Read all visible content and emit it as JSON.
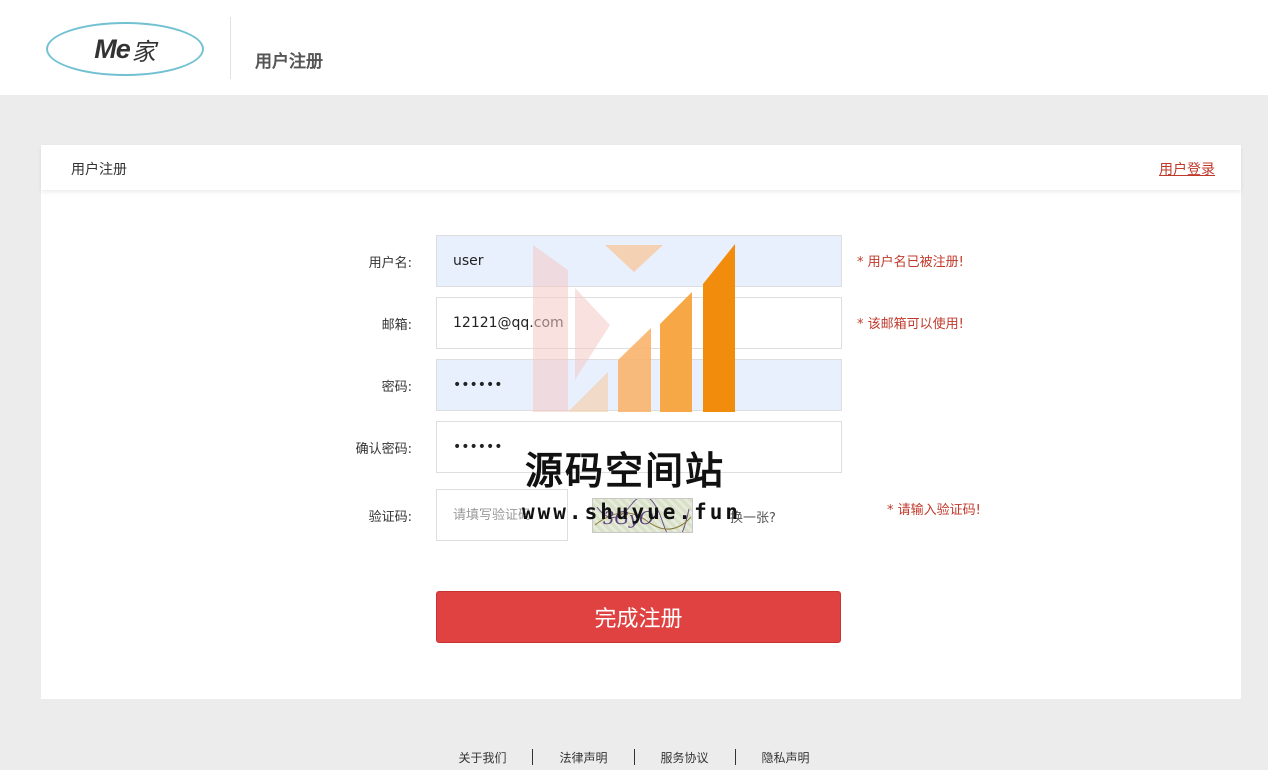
{
  "header": {
    "logo_text": "Me",
    "logo_text_cn": "家",
    "title": "用户注册"
  },
  "panel": {
    "title": "用户注册",
    "login_link": "用户登录"
  },
  "form": {
    "username": {
      "label": "用户名:",
      "value": "user",
      "hint": "* 用户名已被注册!"
    },
    "email": {
      "label": "邮箱:",
      "value": "12121@qq.com",
      "hint": "* 该邮箱可以使用!"
    },
    "password": {
      "label": "密码:",
      "value": "123456"
    },
    "confirm_password": {
      "label": "确认密码:",
      "value": "123456"
    },
    "captcha": {
      "label": "验证码:",
      "placeholder": "请填写验证码",
      "image_text": "3GyO",
      "refresh": "换一张?",
      "hint": "* 请输入验证码!"
    },
    "submit": "完成注册"
  },
  "watermark": {
    "title": "源码空间站",
    "url": "www.shuyue.fun"
  },
  "footer": {
    "links": [
      "关于我们",
      "法律声明",
      "服务协议",
      "隐私声明"
    ]
  },
  "colors": {
    "accent": "#e04141",
    "hint": "#c0392b",
    "logo_border": "#72c1d3",
    "autofill": "#e8f0fe",
    "background": "#ececec"
  }
}
